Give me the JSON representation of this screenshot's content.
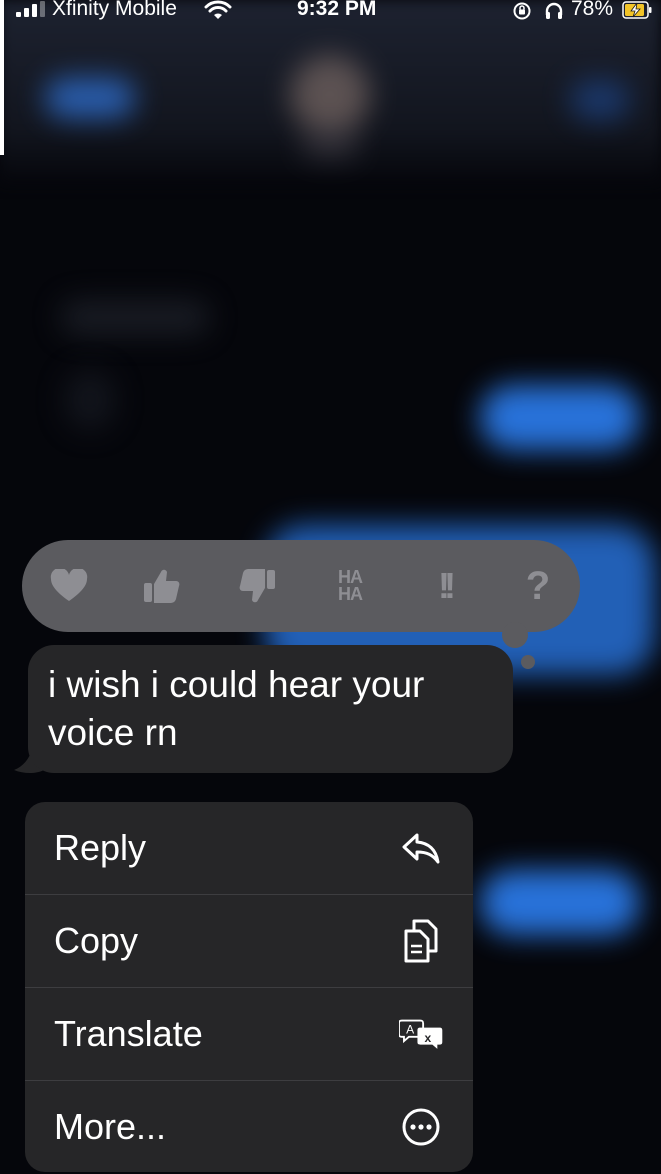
{
  "status_bar": {
    "carrier": "Xfinity Mobile",
    "time": "9:32 PM",
    "battery_percent": "78%",
    "icons": [
      "signal-icon",
      "wifi-icon",
      "rotation-lock-icon",
      "headphones-icon",
      "battery-charging-icon"
    ]
  },
  "tapback": {
    "options": [
      {
        "name": "heart",
        "icon": "heart-icon"
      },
      {
        "name": "thumbs-up",
        "icon": "thumbs-up-icon"
      },
      {
        "name": "thumbs-down",
        "icon": "thumbs-down-icon"
      },
      {
        "name": "haha",
        "icon": "haha-icon",
        "label_line1": "HA",
        "label_line2": "HA"
      },
      {
        "name": "emphasize",
        "icon": "double-exclamation-icon",
        "label": "!!"
      },
      {
        "name": "question",
        "icon": "question-mark-icon",
        "label": "?"
      }
    ]
  },
  "message": {
    "text": "i wish i could hear your voice rn"
  },
  "context_menu": {
    "items": [
      {
        "label": "Reply",
        "icon": "reply-arrow-icon"
      },
      {
        "label": "Copy",
        "icon": "copy-icon"
      },
      {
        "label": "Translate",
        "icon": "translate-icon"
      },
      {
        "label": "More...",
        "icon": "more-ellipsis-icon"
      }
    ]
  },
  "colors": {
    "background": "#05060b",
    "bubble": "#262628",
    "tapback_bar": "#5b5b5f",
    "tapback_icon": "#8e8e93",
    "blurred_blue": "#2c7ef0"
  }
}
